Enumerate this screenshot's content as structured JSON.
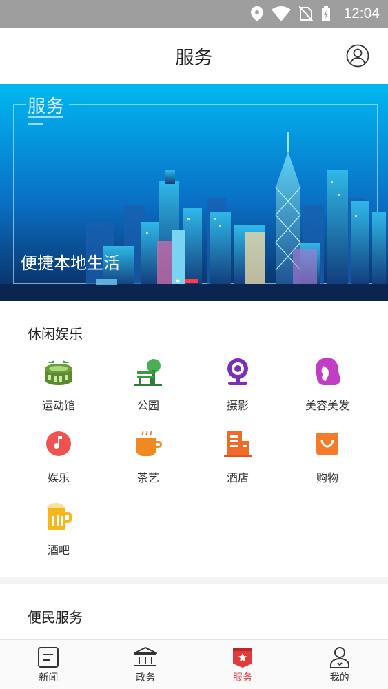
{
  "status_bar": {
    "time": "12:04"
  },
  "header": {
    "title": "服务"
  },
  "banner": {
    "title": "服务",
    "subtitle": "便捷本地生活"
  },
  "leisure": {
    "title": "休闲娱乐",
    "items": [
      {
        "label": "运动馆",
        "icon": "stadium-icon"
      },
      {
        "label": "公园",
        "icon": "park-icon"
      },
      {
        "label": "摄影",
        "icon": "camera-icon"
      },
      {
        "label": "美容美发",
        "icon": "beauty-icon"
      },
      {
        "label": "娱乐",
        "icon": "music-icon"
      },
      {
        "label": "茶艺",
        "icon": "tea-icon"
      },
      {
        "label": "酒店",
        "icon": "hotel-icon"
      },
      {
        "label": "购物",
        "icon": "shopping-icon"
      },
      {
        "label": "酒吧",
        "icon": "beer-icon"
      }
    ]
  },
  "convenience": {
    "title": "便民服务"
  },
  "tabbar": {
    "tabs": [
      {
        "label": "新闻",
        "icon": "news-icon",
        "active": false
      },
      {
        "label": "政务",
        "icon": "government-icon",
        "active": false
      },
      {
        "label": "服务",
        "icon": "service-icon",
        "active": true
      },
      {
        "label": "我的",
        "icon": "profile-icon",
        "active": false
      }
    ]
  },
  "colors": {
    "accent": "#e03a3a",
    "banner_top": "#00b4f0",
    "banner_bottom": "#0a2a5c"
  }
}
